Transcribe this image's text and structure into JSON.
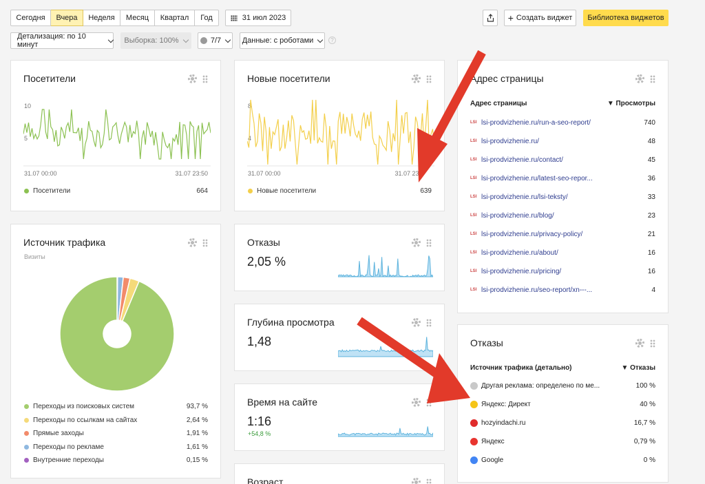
{
  "toolbar": {
    "periods": [
      "Сегодня",
      "Вчера",
      "Неделя",
      "Месяц",
      "Квартал",
      "Год"
    ],
    "active_period": "Вчера",
    "date": "31 июл 2023",
    "create_widget": "Создать виджет",
    "library": "Библиотека виджетов",
    "detail": "Детализация: по 10 минут",
    "sample": "Выборка: 100%",
    "segments": "7/7",
    "data_filter": "Данные: с роботами"
  },
  "visitors": {
    "title": "Посетители",
    "y_max": "10",
    "y_mid": "5",
    "x_start": "31.07 00:00",
    "x_end": "31.07 23:50",
    "legend": "Посетители",
    "total": "664",
    "color": "#8cc152"
  },
  "new_visitors": {
    "title": "Новые посетители",
    "y_max": "8",
    "y_mid": "4",
    "x_start": "31.07 00:00",
    "x_end": "31.07 23:",
    "legend": "Новые посетители",
    "total": "639",
    "color": "#f3cf4b"
  },
  "pages": {
    "title": "Адрес страницы",
    "col1": "Адрес страницы",
    "col2": "▼ Просмотры",
    "rows": [
      {
        "url": "lsi-prodvizhenie.ru/run-a-seo-report/",
        "views": "740"
      },
      {
        "url": "lsi-prodvizhenie.ru/",
        "views": "48"
      },
      {
        "url": "lsi-prodvizhenie.ru/contact/",
        "views": "45"
      },
      {
        "url": "lsi-prodvizhenie.ru/latest-seo-repor...",
        "views": "36"
      },
      {
        "url": "lsi-prodvizhenie.ru/lsi-teksty/",
        "views": "33"
      },
      {
        "url": "lsi-prodvizhenie.ru/blog/",
        "views": "23"
      },
      {
        "url": "lsi-prodvizhenie.ru/privacy-policy/",
        "views": "21"
      },
      {
        "url": "lsi-prodvizhenie.ru/about/",
        "views": "16"
      },
      {
        "url": "lsi-prodvizhenie.ru/pricing/",
        "views": "16"
      },
      {
        "url": "lsi-prodvizhenie.ru/seo-report/xn---...",
        "views": "4"
      }
    ]
  },
  "traffic": {
    "title": "Источник трафика",
    "subtitle": "Визиты",
    "items": [
      {
        "label": "Переходы из поисковых систем",
        "value": "93,7 %",
        "share": 93.7,
        "color": "#a4cd6e"
      },
      {
        "label": "Переходы по ссылкам на сайтах",
        "value": "2,64 %",
        "share": 2.64,
        "color": "#f5da7a"
      },
      {
        "label": "Прямые заходы",
        "value": "1,91 %",
        "share": 1.91,
        "color": "#f28b6b"
      },
      {
        "label": "Переходы по рекламе",
        "value": "1,61 %",
        "share": 1.61,
        "color": "#8fb8e0"
      },
      {
        "label": "Внутренние переходы",
        "value": "0,15 %",
        "share": 0.15,
        "color": "#a361c0"
      }
    ]
  },
  "bounce": {
    "title": "Отказы",
    "value": "2,05 %"
  },
  "depth": {
    "title": "Глубина просмотра",
    "value": "1,48"
  },
  "time": {
    "title": "Время на сайте",
    "value": "1:16",
    "delta": "+54,8 %"
  },
  "age": {
    "title": "Возраст"
  },
  "bounce_src": {
    "title": "Отказы",
    "col1": "Источник трафика (детально)",
    "col2": "▼ Отказы",
    "rows": [
      {
        "name": "Другая реклама: определено по ме...",
        "value": "100 %",
        "color": "#c9c9c9"
      },
      {
        "name": "Яндекс: Директ",
        "value": "40 %",
        "color": "#f5c518"
      },
      {
        "name": "hozyindachi.ru",
        "value": "16,7 %",
        "color": "#e02b2b"
      },
      {
        "name": "Яндекс",
        "value": "0,79 %",
        "color": "#e8342f"
      },
      {
        "name": "Google",
        "value": "0 %",
        "color": "#4285f4"
      }
    ]
  }
}
